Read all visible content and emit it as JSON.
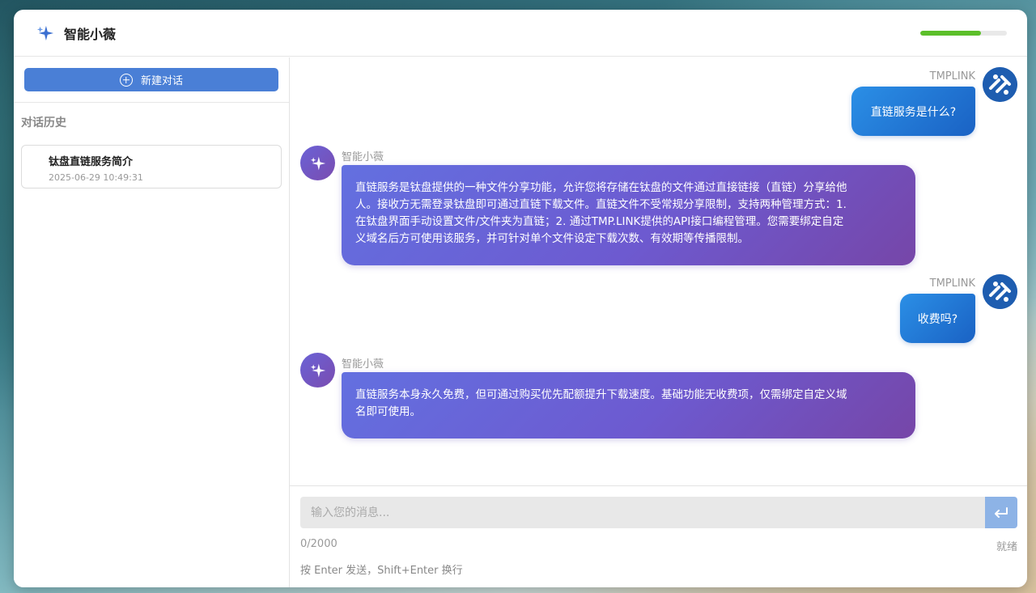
{
  "app": {
    "title": "智能小薇",
    "progress_percent": 70
  },
  "sidebar": {
    "new_chat_label": "新建对话",
    "history_title": "对话历史",
    "history": [
      {
        "title": "钛盘直链服务简介",
        "time": "2025-06-29 10:49:31"
      }
    ]
  },
  "chat": {
    "messages": [
      {
        "role": "user",
        "name": "TMPLINK",
        "text": "直链服务是什么?"
      },
      {
        "role": "ai",
        "name": "智能小薇",
        "lines": [
          "直链服务是钛盘提供的一种文件分享功能，允许您将存储在钛盘的文件通过直接链接（直链）分享给他",
          "人。接收方无需登录钛盘即可通过直链下载文件。直链文件不受常规分享限制，支持两种管理方式：1.",
          "在钛盘界面手动设置文件/文件夹为直链；2. 通过TMP.LINK提供的API接口编程管理。您需要绑定自定",
          "义域名后方可使用该服务，并可针对单个文件设定下载次数、有效期等传播限制。"
        ]
      },
      {
        "role": "user",
        "name": "TMPLINK",
        "text": "收费吗?"
      },
      {
        "role": "ai",
        "name": "智能小薇",
        "lines": [
          "直链服务本身永久免费，但可通过购买优先配额提升下载速度。基础功能无收费项，仅需绑定自定义域",
          "名即可使用。"
        ]
      }
    ]
  },
  "input": {
    "placeholder": "输入您的消息...",
    "counter": "0/2000",
    "status": "就绪",
    "hint": "按 Enter 发送，Shift+Enter 换行"
  },
  "colors": {
    "accent": "#4a7fd6",
    "user_bubble": "#1a62c4",
    "ai_bubble": "#6d5ad0",
    "progress": "#5cbf2a"
  }
}
